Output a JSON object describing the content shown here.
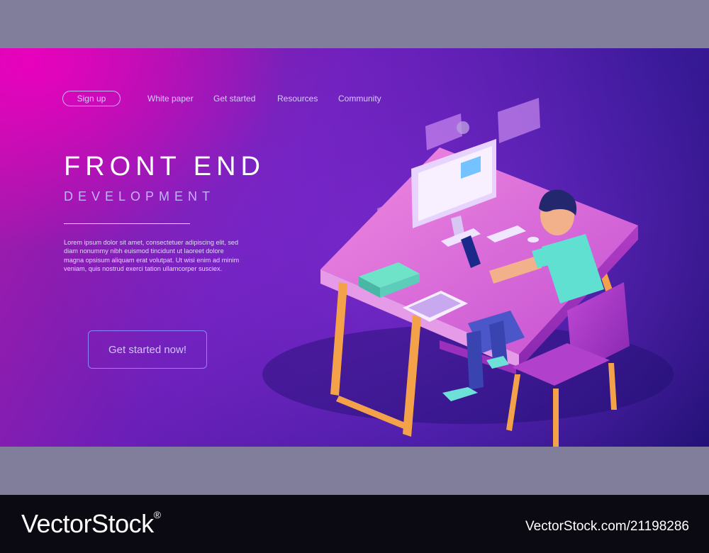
{
  "nav": {
    "signup_label": "Sign up",
    "links": [
      "White paper",
      "Get started",
      "Resources",
      "Community"
    ]
  },
  "hero": {
    "title": "FRONT END",
    "subtitle": "DEVELOPMENT",
    "body": "Lorem ipsum dolor sit amet, consectetuer adipiscing elit, sed diam nonummy nibh euismod tincidunt ut laoreet dolore magna opsisum aliquam erat volutpat. Ut wisi enim ad minim veniam, quis nostrud exerci tation ullamcorper susciex.",
    "cta_label": "Get started now!"
  },
  "watermark": {
    "brand": "VectorStock",
    "registered": "®",
    "url": "VectorStock.com/21198286"
  },
  "colors": {
    "accent": "#c9b6ff",
    "hero_pink": "#ec00be",
    "hero_deep": "#231277",
    "desk_top": "#d46ad8",
    "chair": "#a43ac8",
    "shirt": "#5fe0d0"
  }
}
